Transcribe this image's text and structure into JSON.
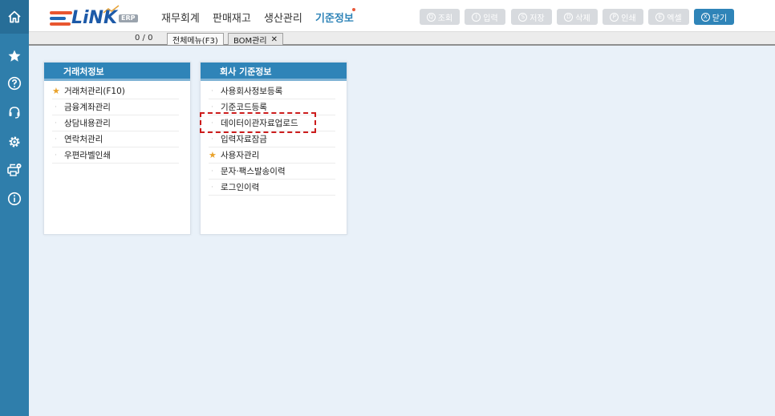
{
  "sidebar": {
    "items": [
      {
        "name": "home",
        "icon": "home-icon"
      },
      {
        "name": "favorites",
        "icon": "star-icon"
      },
      {
        "name": "help",
        "icon": "question-icon"
      },
      {
        "name": "support",
        "icon": "headset-icon"
      },
      {
        "name": "settings",
        "icon": "gear-icon"
      },
      {
        "name": "print-settings",
        "icon": "printer-gear-icon"
      },
      {
        "name": "info",
        "icon": "info-icon"
      }
    ]
  },
  "header": {
    "logo_text": "LiNK",
    "logo_badge": "ERP",
    "menus": [
      {
        "label": "재무회계",
        "active": false
      },
      {
        "label": "판매재고",
        "active": false
      },
      {
        "label": "생산관리",
        "active": false
      },
      {
        "label": "기준정보",
        "active": true
      }
    ],
    "toolbar": [
      {
        "key": "Q",
        "label": "조회",
        "enabled": false
      },
      {
        "key": "I",
        "label": "입력",
        "enabled": false
      },
      {
        "key": "S",
        "label": "저장",
        "enabled": false
      },
      {
        "key": "D",
        "label": "삭제",
        "enabled": false
      },
      {
        "key": "P",
        "label": "인쇄",
        "enabled": false
      },
      {
        "key": "E",
        "label": "엑셀",
        "enabled": false
      },
      {
        "key": "X",
        "label": "닫기",
        "enabled": true
      }
    ]
  },
  "tabs": {
    "pager": "0 / 0",
    "items": [
      {
        "label": "전체메뉴(F3)",
        "closable": false,
        "active": true
      },
      {
        "label": "BOM관리",
        "closable": true,
        "active": false
      }
    ],
    "close_symbol": "✕"
  },
  "cards": [
    {
      "title": "거래처정보",
      "items": [
        {
          "label": "거래처관리(F10)",
          "starred": true
        },
        {
          "label": "금융계좌관리",
          "starred": false
        },
        {
          "label": "상담내용관리",
          "starred": false
        },
        {
          "label": "연락처관리",
          "starred": false
        },
        {
          "label": "우편라벨인쇄",
          "starred": false
        }
      ]
    },
    {
      "title": "회사 기준정보",
      "items": [
        {
          "label": "사용회사정보등록",
          "starred": false
        },
        {
          "label": "기준코드등록",
          "starred": false
        },
        {
          "label": "데이터이관자료업로드",
          "starred": false
        },
        {
          "label": "입력자료잠금",
          "starred": false
        },
        {
          "label": "사용자관리",
          "starred": true
        },
        {
          "label": "문자·팩스발송이력",
          "starred": false
        },
        {
          "label": "로그인이력",
          "starred": false
        }
      ]
    }
  ],
  "colors": {
    "rail": "#2f7eab",
    "accent": "#2f84b8",
    "star": "#e9a22a",
    "highlight": "#cc1c1c"
  }
}
